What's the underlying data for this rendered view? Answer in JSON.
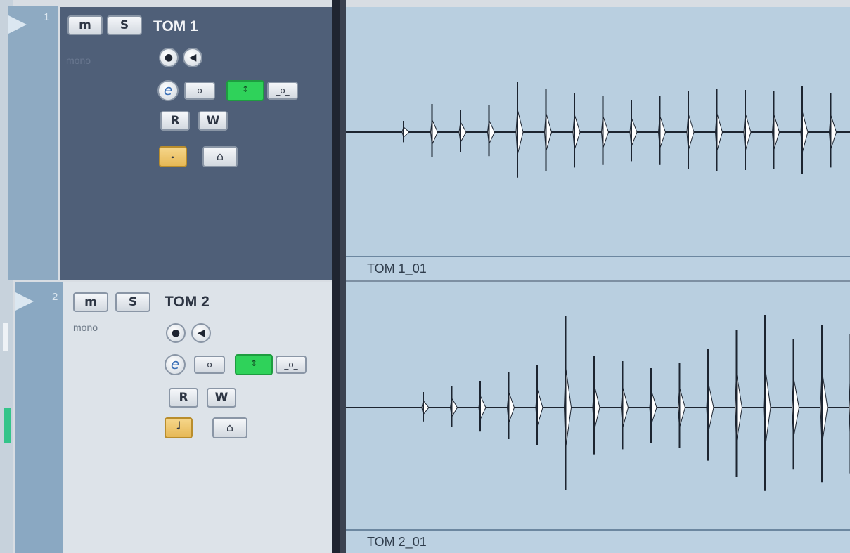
{
  "tracks": [
    {
      "number": "1",
      "name": "TOM 1",
      "mono_label": "mono",
      "mute_label": "m",
      "solo_label": "S",
      "read_label": "R",
      "write_label": "W",
      "edit_label": "e",
      "clip_name": "TOM 1_01",
      "selected": true
    },
    {
      "number": "2",
      "name": "TOM 2",
      "mono_label": "mono",
      "mute_label": "m",
      "solo_label": "S",
      "read_label": "R",
      "write_label": "W",
      "edit_label": "e",
      "clip_name": "TOM 2_01",
      "selected": false
    }
  ],
  "icons": {
    "play": "play-icon",
    "record": "record-icon",
    "monitor": "speaker-icon",
    "edit": "edit-channel-icon",
    "insert": "insert-icon",
    "active": "arrows-icon",
    "output": "output-icon",
    "note": "music-note-icon",
    "lock": "lock-icon"
  },
  "colors": {
    "selected_header": "#4f5f78",
    "unselected_header": "#dde3e9",
    "waveform_bg": "#b9cfe0",
    "active_green": "#2fd25a",
    "note_button": "#e6b856"
  }
}
